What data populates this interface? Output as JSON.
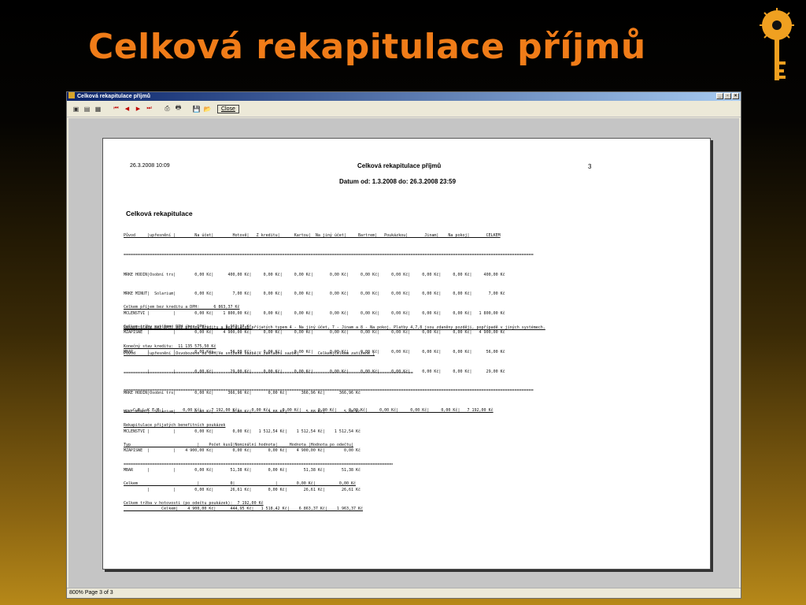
{
  "slide": {
    "title": "Celková rekapitulace příjmů"
  },
  "window": {
    "title": "Celková rekapitulace příjmů",
    "controls": [
      "_",
      "▫",
      "×"
    ],
    "close_label": "Close",
    "status": "800% Page 3 of 3"
  },
  "report": {
    "datetime": "26.3.2008 10:09",
    "title": "Celková rekapitulace příjmů",
    "page_number": "3",
    "date_range": "Datum od: 1.3.2008  do: 26.3.2008 23:59",
    "section_title": "Celková rekapitulace",
    "table1_header": "Původ     |upřesnění |        Na účet|        Hotově|   Z kreditu|      Kartou|  Na jiný účet|     Bartrem|   Poukázkou|       Jinam|    Na pokoj|       CELKEM",
    "rule": "=============================================================================================================================================================================",
    "table1_rows": [
      "MRKE HODIN|Osobní trs|        0,00 Kč|      400,00 Kč|     0,00 Kč|     0,00 Kč|       0,00 Kč|     0,00 Kč|     0,00 Kč|     0,00 Kč|     0,00 Kč|     400,00 Kč",
      "MRKE MINUT|  Solarium|        0,00 Kč|        7,00 Kč|     0,00 Kč|     0,00 Kč|       0,00 Kč|     0,00 Kč|     0,00 Kč|     0,00 Kč|     0,00 Kč|       7,00 Kč",
      "MCLENSTVI |          |        0,00 Kč|    1 800,00 Kč|     0,00 Kč|     0,00 Kč|       0,00 Kč|     0,00 Kč|     0,00 Kč|     0,00 Kč|     0,00 Kč|   1 800,00 Kč",
      "MZAPISNE  |          |        0,00 Kč|    4 900,00 Kč|     0,00 Kč|     0,00 Kč|       0,00 Kč|     0,00 Kč|     0,00 Kč|     0,00 Kč|     0,00 Kč|   4 900,00 Kč",
      "MBAR      |          |        0,00 Kč|       56,00 Kč|     0,00 Kč|     0,00 Kč|       0,00 Kč|     0,00 Kč|     0,00 Kč|     0,00 Kč|     0,00 Kč|      56,00 Kč",
      "          |          |        0,00 Kč|       29,00 Kč|     0,00 Kč|     0,00 Kč|       0,00 Kč|     0,00 Kč|     0,00 Kč|     0,00 Kč|     0,00 Kč|      29,00 Kč"
    ],
    "table1_total": "    C E L K E M |        0,00 Kč|    7 192,00 Kč|     0,00 Kč|     0,00 Kč|       0,00 Kč|     0,00 Kč|     0,00 Kč|     0,00 Kč|     0,00 Kč|   7 192,00 Kč",
    "summary_lines": [
      "Celkem příjem bez kreditu a DPH:      6 863,37 Kč",
      "Celkem tržby zatížené DPH (bez DPH):       1 963,37 Kč",
      "Konečný stav kreditu:  11 135 575,50 Kč"
    ],
    "note": "Rekapitulace bez DPH, bez příjmu kreditu a bez plateb příjatých typem 4 - Na jiný účet, 7 - Jinam a 8 - Na pokoj. Platby 4,7,8 jsou zdaněny později, popřípadě v jiných systémech.",
    "table2_header": "Původ     |upřesnění |Osvobozeno od DPH|Ve snížené sazbě|V základní sazbě|        Celkem|Celkem zatížené |",
    "table2_rows": [
      "MRKE HODIN|Osobní trs|        0,00 Kč|      366,96 Kč|       0,00 Kč|      366,96 Kč|      366,96 Kč",
      "MRKE MINUT|  Solarium|        0,00 Kč|        0,00 Kč|       5,88 Kč|        5,88 Kč|        5,88 Kč",
      "MCLENSTVI |          |        0,00 Kč|        0,00 Kč|   1 512,54 Kč|    1 512,54 Kč|    1 512,54 Kč",
      "MZAPISNE  |          |    4 900,00 Kč|        0,00 Kč|       0,00 Kč|    4 900,00 Kč|        0,00 Kč",
      "MBAR      |          |        0,00 Kč|       51,38 Kč|       0,00 Kč|       51,38 Kč|       51,38 Kč",
      "          |          |        0,00 Kč|       26,61 Kč|       0,00 Kč|       26,61 Kč|       26,61 Kč"
    ],
    "table2_total": "                Celkem|    4 900,00 Kč|      444,95 Kč|   1 518,42 Kč|    6 863,37 Kč|    1 963,37 Kč",
    "vouchers_title": "Rekapitulace přijatých benefitních poukázek",
    "vouchers_header": "Typ                            |    Počet kusů|Nominální hodnota|     Hodnota |Hodnota po odečtu|",
    "vouchers_row": "Celkem                         |             0|                 |        0,00 Kč|          0,00 Kč",
    "vouchers_total": "Celkem tržba v hotovosti (po odečtu poukázek):  7 192,00 Kč"
  }
}
